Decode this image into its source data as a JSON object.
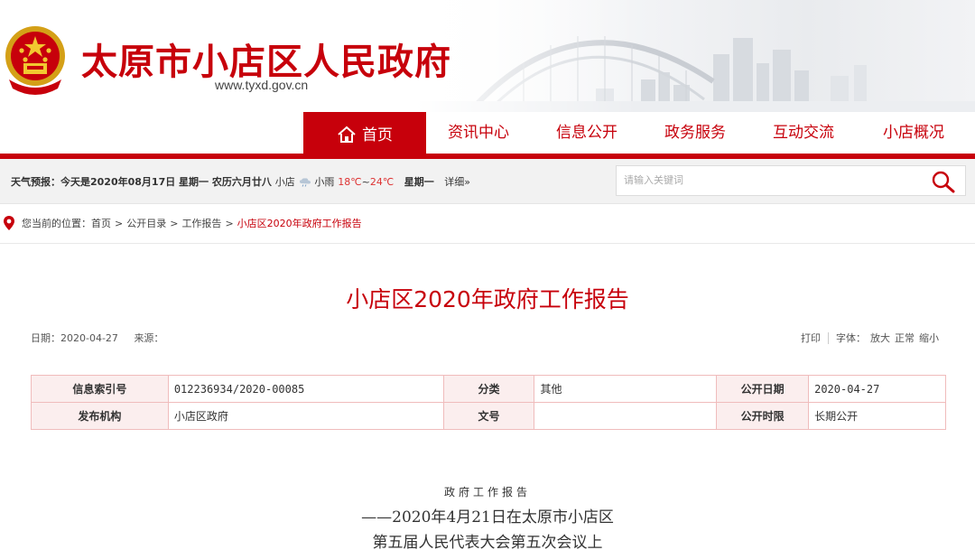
{
  "header": {
    "site_title": "太原市小店区人民政府",
    "site_url": "www.tyxd.gov.cn"
  },
  "nav": {
    "items": [
      {
        "label": "首页",
        "active": true
      },
      {
        "label": "资讯中心"
      },
      {
        "label": "信息公开"
      },
      {
        "label": "政务服务"
      },
      {
        "label": "互动交流"
      },
      {
        "label": "小店概况"
      }
    ]
  },
  "weather": {
    "prefix": "天气预报：今天是2020年08月17日 星期一 农历六月廿八",
    "location": "小店",
    "condition": "小雨",
    "temp_low": "18℃",
    "tilde": "~",
    "temp_high": "24℃",
    "weekday": "星期一",
    "detail": "详细»"
  },
  "search": {
    "placeholder": "请输入关键词"
  },
  "breadcrumb": {
    "prefix": "您当前的位置：",
    "items": [
      "首页",
      "公开目录",
      "工作报告",
      "小店区2020年政府工作报告"
    ],
    "sep": ">"
  },
  "article": {
    "title": "小店区2020年政府工作报告",
    "date": "日期：2020-04-27",
    "source": "来源：",
    "print": "打印",
    "font_label": "字体：",
    "font_large": "放大",
    "font_normal": "正常",
    "font_small": "缩小"
  },
  "info_table": {
    "rows": [
      {
        "k1": "信息索引号",
        "v1": "012236934/2020-00085",
        "k2": "分类",
        "v2": "其他",
        "k3": "公开日期",
        "v3": "2020-04-27"
      },
      {
        "k1": "发布机构",
        "v1": "小店区政府",
        "k2": "文号",
        "v2": "",
        "k3": "公开时限",
        "v3": "长期公开"
      }
    ]
  },
  "body": {
    "heading": "政府工作报告",
    "line1": "——2020年4月21日在太原市小店区",
    "line2": "第五届人民代表大会第五次会议上"
  },
  "colors": {
    "brand_red": "#c7000b",
    "table_border": "#f0bcbc",
    "table_key_bg": "#fbeeee"
  }
}
